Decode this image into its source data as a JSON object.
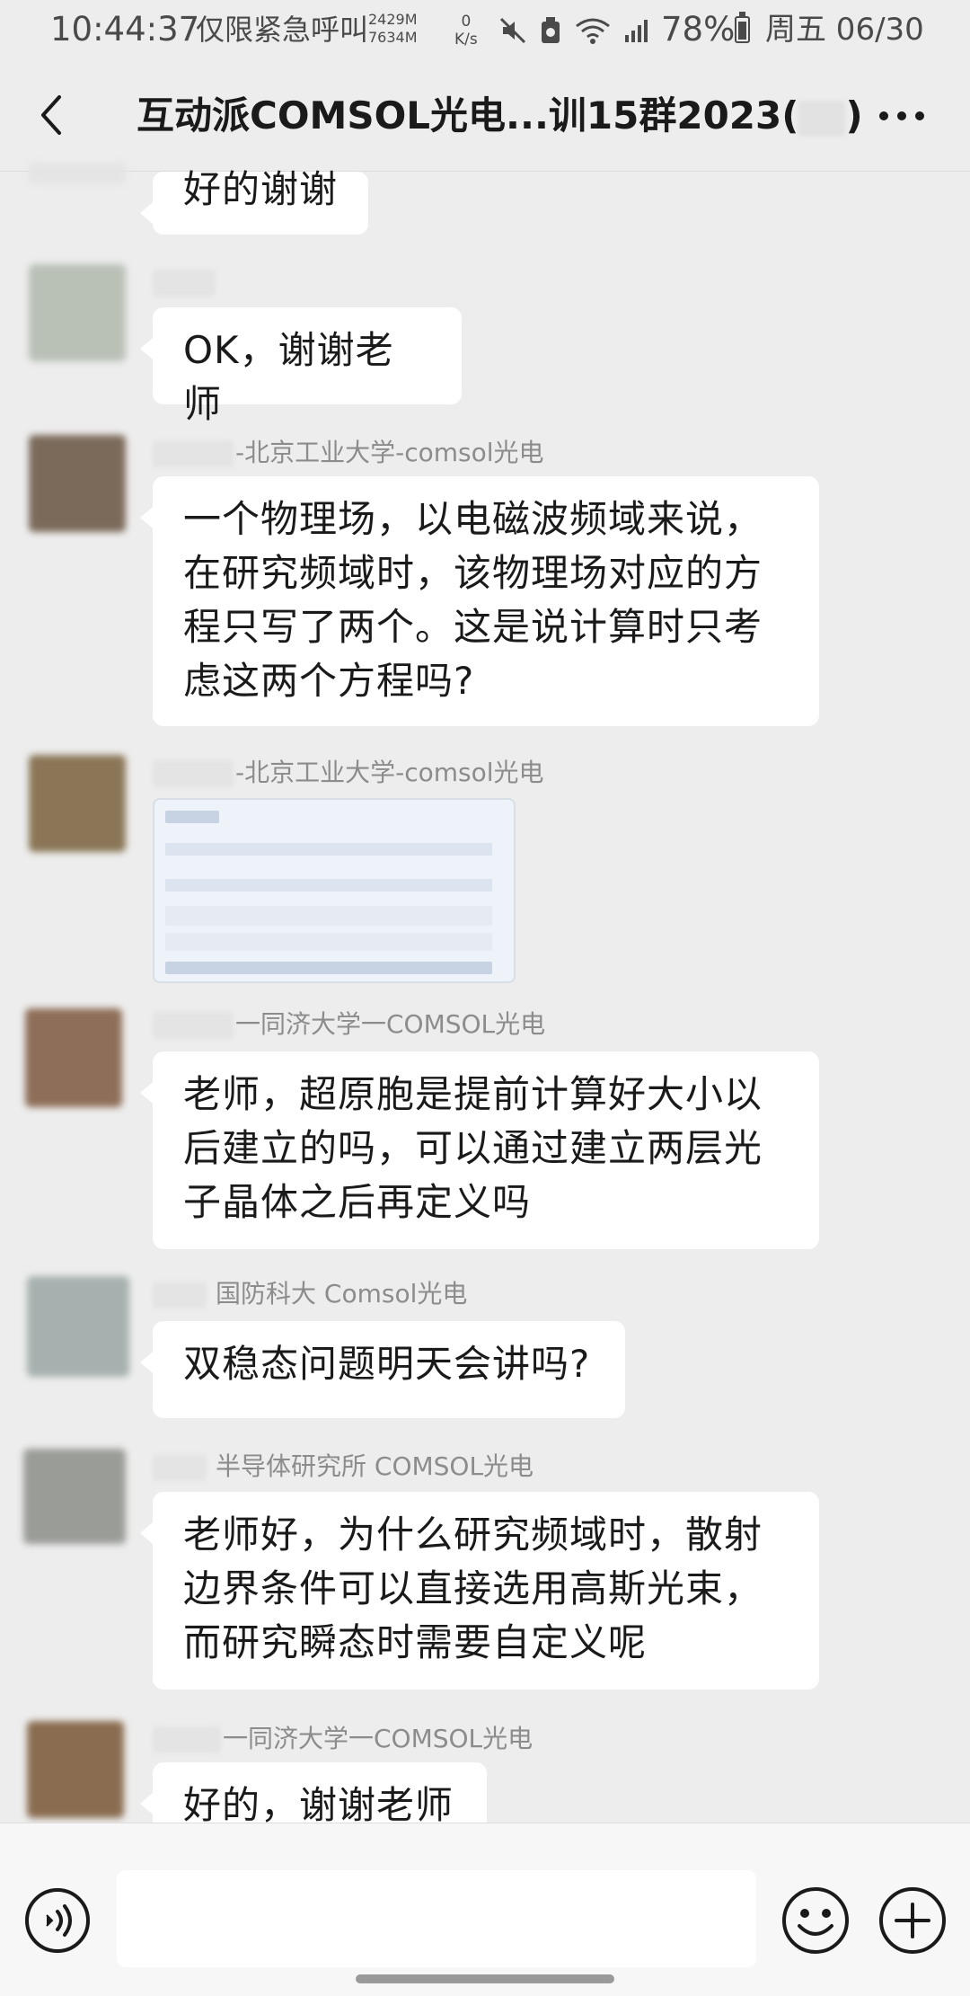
{
  "status_bar": {
    "time": "10:44:37",
    "carrier": "仅限紧急呼叫",
    "mem_top": "2429M",
    "mem_bottom": "7634M",
    "net_speed": "0",
    "net_unit": "K/s",
    "battery_text": "78%",
    "battery_level": 0.78,
    "date": "周五 06/30"
  },
  "header": {
    "title": "互动派COMSOL光电...训15群2023(",
    "title_end": ")"
  },
  "messages": [
    {
      "sender": "",
      "text": "好的谢谢"
    },
    {
      "sender": "",
      "text": "OK，谢谢老师"
    },
    {
      "sender": "-北京工业大学-comsol光电",
      "text": "一个物理场，以电磁波频域来说，在研究频域时，该物理场对应的方程只写了两个。这是说计算时只考虑这两个方程吗?"
    },
    {
      "sender": "-北京工业大学-comsol光电",
      "image": "equation-screenshot"
    },
    {
      "sender": "一同济大学一COMSOL光电",
      "text": "老师，超原胞是提前计算好大小以后建立的吗，可以通过建立两层光子晶体之后再定义吗"
    },
    {
      "sender": "国防科大 Comsol光电",
      "text": "双稳态问题明天会讲吗?"
    },
    {
      "sender": "半导体研究所 COMSOL光电",
      "text": "老师好，为什么研究频域时，散射边界条件可以直接选用高斯光束，而研究瞬态时需要自定义呢"
    },
    {
      "sender": "一同济大学一COMSOL光电",
      "text": "好的，谢谢老师"
    }
  ],
  "input": {
    "value": ""
  },
  "colors": {
    "background": "#ededed",
    "bubble": "#ffffff",
    "sender_text": "#8c8c8c"
  }
}
